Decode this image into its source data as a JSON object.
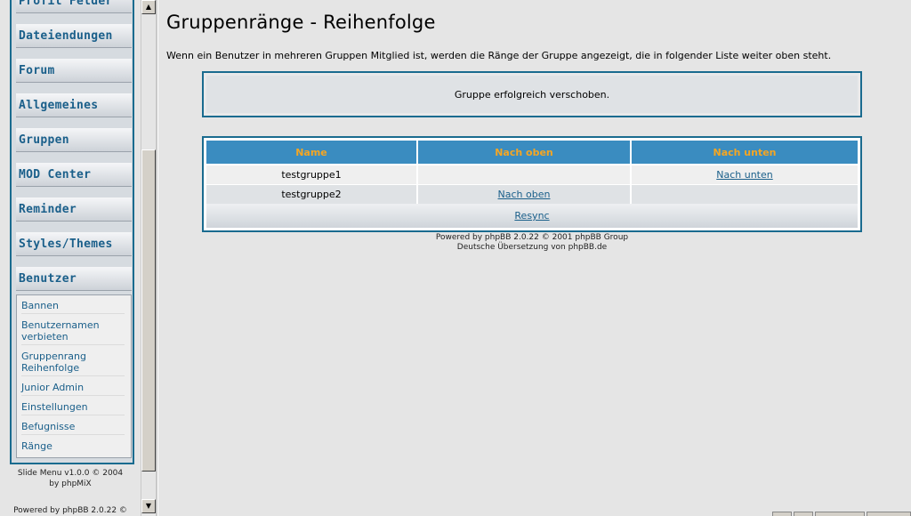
{
  "sidebar": {
    "menu": [
      {
        "label": "Profil Felder"
      },
      {
        "label": "Dateiendungen"
      },
      {
        "label": "Forum"
      },
      {
        "label": "Allgemeines"
      },
      {
        "label": "Gruppen"
      },
      {
        "label": "MOD Center"
      },
      {
        "label": "Reminder"
      },
      {
        "label": "Styles/Themes"
      },
      {
        "label": "Benutzer"
      }
    ],
    "submenu": [
      {
        "label": "Bannen"
      },
      {
        "label": "Benutzernamen verbieten"
      },
      {
        "label": "Gruppenrang Reihenfolge"
      },
      {
        "label": "Junior Admin"
      },
      {
        "label": "Einstellungen"
      },
      {
        "label": "Befugnisse"
      },
      {
        "label": "Ränge"
      }
    ],
    "credit_line1": "Slide Menu v1.0.0 © 2004",
    "credit_line2": "by phpMiX",
    "powered_partial": "Powered by phpBB 2.0.22 ©"
  },
  "main": {
    "title": "Gruppenränge - Reihenfolge",
    "description": "Wenn ein Benutzer in mehreren Gruppen Mitglied ist, werden die Ränge der Gruppe angezeigt, die in folgender Liste weiter oben steht.",
    "message": "Gruppe erfolgreich verschoben.",
    "table": {
      "headers": [
        "Name",
        "Nach oben",
        "Nach unten"
      ],
      "rows": [
        {
          "name": "testgruppe1",
          "up": "",
          "down": "Nach unten"
        },
        {
          "name": "testgruppe2",
          "up": "Nach oben",
          "down": ""
        }
      ],
      "resync": "Resync"
    },
    "footer_line1": "Powered by phpBB 2.0.22 © 2001 phpBB Group",
    "footer_line2": "Deutsche Übersetzung von phpBB.de"
  },
  "colors": {
    "frame_border": "#1a6b8f",
    "header_bg": "#3a8cc0",
    "header_text": "#f5a623",
    "link": "#1a5f8a"
  }
}
